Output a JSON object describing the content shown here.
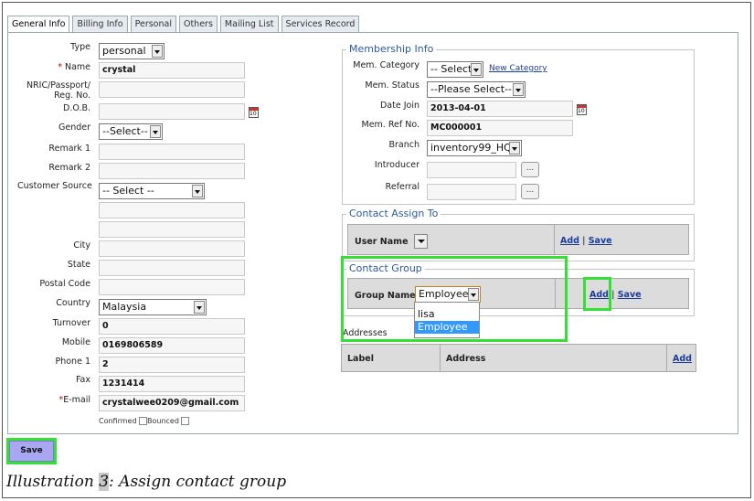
{
  "tabs": [
    "General Info",
    "Billing Info",
    "Personal",
    "Others",
    "Mailing List",
    "Services Record"
  ],
  "left_form": {
    "type_label": "Type",
    "type_value": "personal",
    "name_label": "Name",
    "name_value": "crystal",
    "nric_label_1": "NRIC/Passport/",
    "nric_label_2": "Reg. No.",
    "dob_label": "D.O.B.",
    "gender_label": "Gender",
    "gender_value": "--Select--",
    "remark1_label": "Remark 1",
    "remark2_label": "Remark 2",
    "customer_source_label": "Customer Source",
    "customer_source_value": "-- Select --",
    "city_label": "City",
    "state_label": "State",
    "postal_label": "Postal Code",
    "country_label": "Country",
    "country_value": "Malaysia",
    "turnover_label": "Turnover",
    "turnover_value": "0",
    "mobile_label": "Mobile",
    "mobile_value": "0169806589",
    "phone_label": "Phone 1",
    "phone_value": "2",
    "fax_label": "Fax",
    "fax_value": "1231414",
    "email_label": "E-mail",
    "email_value": "crystalwee0209@gmail.com",
    "confirmed_label": "Confirmed",
    "bounced_label": "Bounced"
  },
  "membership": {
    "legend": "Membership Info",
    "category_label": "Mem. Category",
    "category_value": "-- Select",
    "new_category_link": "New Category",
    "status_label": "Mem. Status",
    "status_value": "--Please Select--",
    "date_join_label": "Date Join",
    "date_join_value": "2013-04-01",
    "ref_no_label": "Mem. Ref No.",
    "ref_no_value": "MC000001",
    "branch_label": "Branch",
    "branch_value": "inventory99_HQ",
    "introducer_label": "Introducer",
    "referral_label": "Referral",
    "browse_label": "..."
  },
  "contact_assign": {
    "legend": "Contact Assign To",
    "user_name_label": "User Name",
    "add_link": "Add",
    "sep": "|",
    "save_link": "Save"
  },
  "contact_group": {
    "legend": "Contact Group",
    "group_name_label": "Group Name",
    "group_value": "Employee",
    "dropdown_options": [
      "lisa",
      "Employee"
    ],
    "add_link": "Add",
    "sep": "|",
    "save_link": "Save"
  },
  "addresses": {
    "title": "Addresses",
    "col_label": "Label",
    "col_address": "Address",
    "add_link": "Add"
  },
  "save_button": "Save",
  "caption": {
    "prefix": "Illustration ",
    "number": "3",
    "suffix": ": Assign contact group"
  },
  "colors": {
    "highlight": "#33e033",
    "link": "#1a3c9a",
    "legend": "#2c5aa0",
    "dropdown_selected": "#3399ff",
    "save_button": "#a9a6f2"
  }
}
